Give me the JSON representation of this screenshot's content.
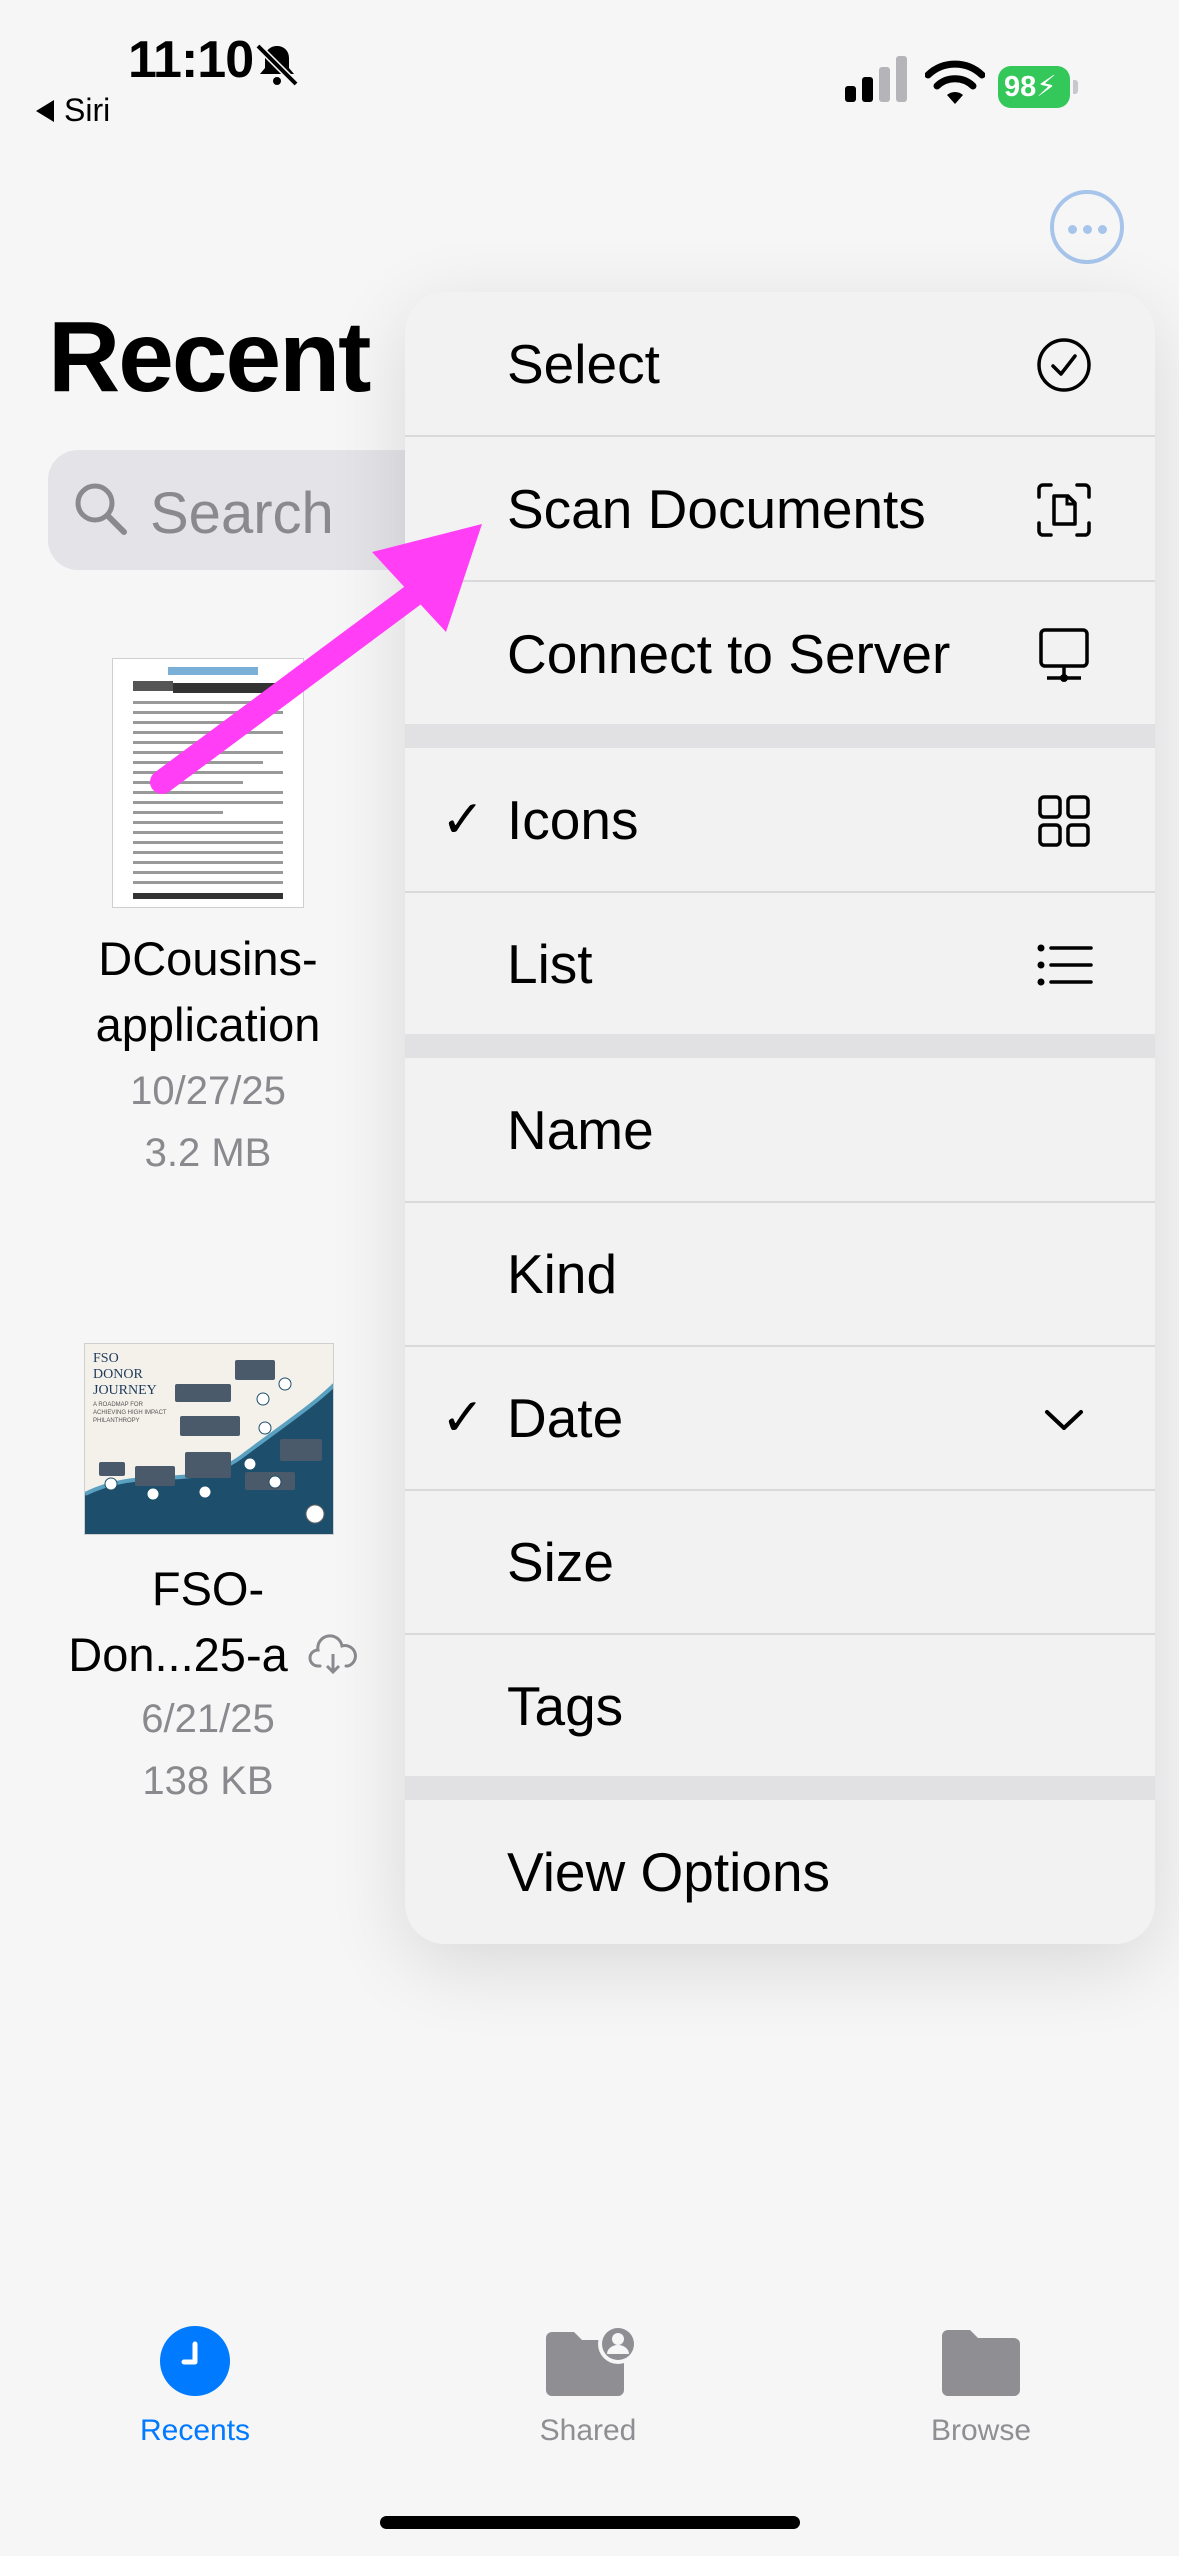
{
  "status_bar": {
    "time": "11:10",
    "back_label": "Siri",
    "battery": "98"
  },
  "header": {
    "title": "Recent",
    "search_placeholder": "Search"
  },
  "files": [
    {
      "name_line1": "DCousins-",
      "name_line2": "application",
      "date": "10/27/25",
      "size": "3.2 MB"
    },
    {
      "name_line1": "FSO-",
      "name_line2": "Don...25-a",
      "date": "6/21/25",
      "size": "138 KB",
      "thumb_text": [
        "FSO",
        "DONOR",
        "JOURNEY",
        "A ROADMAP FOR",
        "ACHIEVING HIGH IMPACT",
        "PHILANTHROPY"
      ]
    }
  ],
  "menu": {
    "select": "Select",
    "scan": "Scan Documents",
    "connect": "Connect to Server",
    "icons": "Icons",
    "list": "List",
    "name": "Name",
    "kind": "Kind",
    "date": "Date",
    "size": "Size",
    "tags": "Tags",
    "view_options": "View Options",
    "checkmark": "✓"
  },
  "tabs": {
    "recents": "Recents",
    "shared": "Shared",
    "browse": "Browse"
  },
  "colors": {
    "accent": "#007aff",
    "annotation_arrow": "#ff3ef5",
    "battery": "#34c759",
    "inactive_tab": "#8e8e93"
  }
}
